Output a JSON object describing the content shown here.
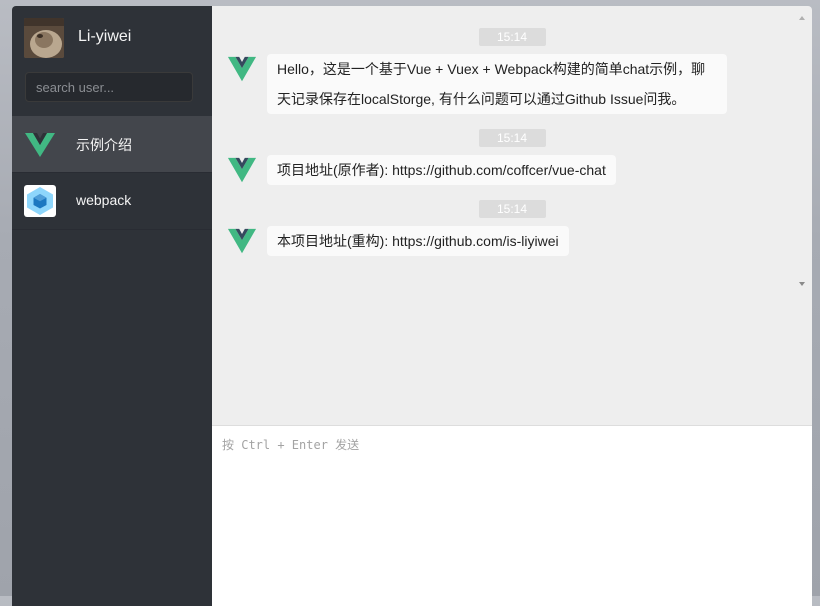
{
  "user": {
    "name": "Li-yiwei",
    "avatar_icon": "user-photo-avatar"
  },
  "search": {
    "placeholder": "search user..."
  },
  "sessions": [
    {
      "name": "示例介绍",
      "icon": "vue-logo-icon",
      "active": true
    },
    {
      "name": "webpack",
      "icon": "webpack-logo-icon",
      "active": false
    }
  ],
  "messages": [
    {
      "time": "15:14",
      "text": "Hello，这是一个基于Vue + Vuex + Webpack构建的简单chat示例，聊天记录保存在localStorge, 有什么问题可以通过Github Issue问我。",
      "avatar_icon": "vue-logo-icon"
    },
    {
      "time": "15:14",
      "text": "项目地址(原作者): https://github.com/coffcer/vue-chat",
      "avatar_icon": "vue-logo-icon"
    },
    {
      "time": "15:14",
      "text": "本项目地址(重构): https://github.com/is-liyiwei",
      "avatar_icon": "vue-logo-icon"
    }
  ],
  "composer": {
    "placeholder": "按 Ctrl + Enter 发送"
  },
  "colors": {
    "sidebar_bg": "#2e3238",
    "message_area_bg": "#eeeeee",
    "bubble_bg": "#fafafa",
    "time_badge_bg": "#dcdcdc",
    "vue_green": "#41b883",
    "vue_dark": "#35495e"
  }
}
